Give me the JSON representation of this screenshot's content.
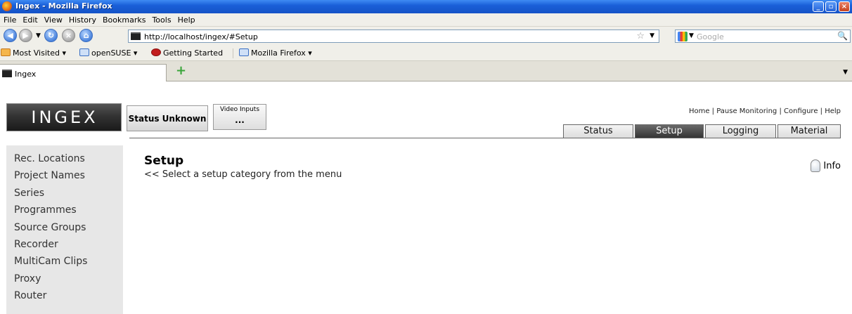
{
  "window": {
    "title": "Ingex - Mozilla Firefox"
  },
  "menu": [
    "File",
    "Edit",
    "View",
    "History",
    "Bookmarks",
    "Tools",
    "Help"
  ],
  "address": {
    "url": "http://localhost/ingex/#Setup",
    "search_placeholder": "Google"
  },
  "bookmarks": [
    "Most Visited ▾",
    "openSUSE ▾",
    "Getting Started",
    "Mozilla Firefox ▾"
  ],
  "tab": {
    "label": "Ingex"
  },
  "header": {
    "logo": "INGEX",
    "status_button": "Status Unknown",
    "video_inputs_label": "Video Inputs",
    "video_inputs_value": "...",
    "top_links": "Home | Pause Monitoring | Configure | Help"
  },
  "nav_tabs": [
    "Status",
    "Setup",
    "Logging",
    "Material"
  ],
  "active_tab": "Setup",
  "sidebar": [
    "Rec. Locations",
    "Project Names",
    "Series",
    "Programmes",
    "Source Groups",
    "Recorder",
    "MultiCam Clips",
    "Proxy",
    "Router"
  ],
  "main": {
    "title": "Setup",
    "subtitle": "<< Select a setup category from the menu",
    "info_label": "Info"
  }
}
